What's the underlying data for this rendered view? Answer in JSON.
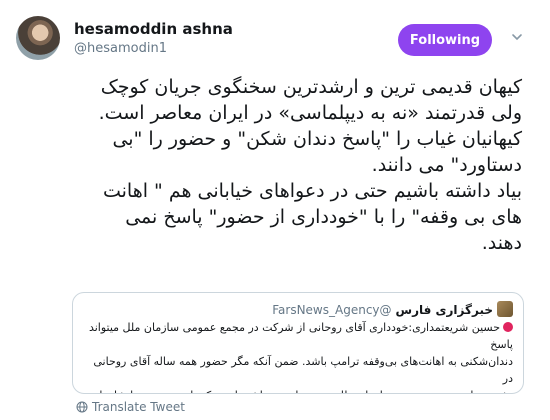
{
  "tweet": {
    "author_name": "hesamoddin ashna",
    "author_handle": "@hesamodin1",
    "follow_label": "Following",
    "text": "کیهان قدیمی ترین و  ارشدترین سخنگوی جریان کوچک\nولی قدرتمند «نه به دیپلماسی» در ایران معاصر است.\nکیهانیان غیاب را \"پاسخ دندان شکن\" و حضور را \"بی\nدستاورد\" می دانند.\nبیاد داشته باشیم حتی در دعواهای خیابانی هم \" اهانت\nهای بی وقفه\" را با \"خودداری از حضور\" پاسخ نمی\nدهند.",
    "translate_label": "Translate Tweet"
  },
  "quoted_tweet": {
    "author_name": "خبرگزاری فارس",
    "author_handle": "@FarsNews_Agency",
    "text": "حسین شریعتمداری:خودداری آقای روحانی از شرکت در مجمع عمومی سازمان ملل میتواند پاسخ\nدندان‌شکنی به اهانت‌های بی‌وقفه ترامپ باشد. ضمن آنکه مگر حضور همه ساله آقای روحانی در\nنشست‌های مجمع عمومی سازمان ملل چه دستاوردی داشته است که با عدم حضور ایشان از دست\nبرود؟!"
  },
  "colors": {
    "follow_button": "#8e44ef",
    "secondary_text": "#657786",
    "border": "#ccd6dd",
    "red_dot": "#e0245e"
  },
  "icons": {
    "caret": "chevron-down-icon",
    "translate": "globe-icon"
  }
}
